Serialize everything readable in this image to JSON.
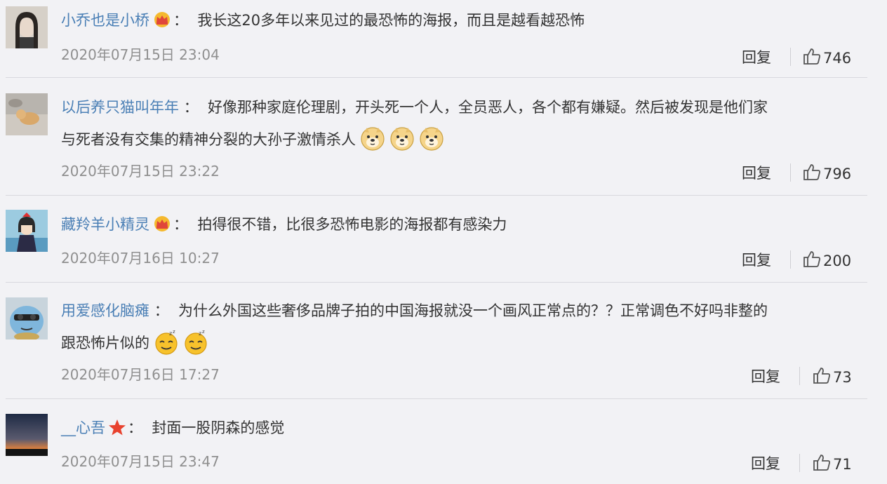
{
  "actions": {
    "reply_label": "回复"
  },
  "comments": [
    {
      "username": "小乔也是小桥",
      "badge": "crown-icon",
      "colon": "：",
      "text_lines": [
        "我长这20多年以来见过的最恐怖的海报，而且是越看越恐怖"
      ],
      "timestamp": "2020年07月15日 23:04",
      "likes": "746"
    },
    {
      "username": "以后养只猫叫年年",
      "badge": "",
      "colon": "：",
      "text_lines": [
        "好像那种家庭伦理剧，开头死一个人，全员恶人，各个都有嫌疑。然后被发现是他们家",
        "与死者没有交集的精神分裂的大孙子激情杀人"
      ],
      "emojis": [
        "doge-emoji",
        "doge-emoji",
        "doge-emoji"
      ],
      "timestamp": "2020年07月15日 23:22",
      "likes": "796"
    },
    {
      "username": "藏羚羊小精灵",
      "badge": "crown-icon",
      "colon": "：",
      "text_lines": [
        "拍得很不错，比很多恐怖电影的海报都有感染力"
      ],
      "timestamp": "2020年07月16日 10:27",
      "likes": "200"
    },
    {
      "username": "用爱感化脑瘫",
      "badge": "",
      "colon": "：",
      "text_lines": [
        "为什么外国这些奢侈品牌子拍的中国海报就没一个画风正常点的？？正常调色不好吗非整的",
        "跟恐怖片似的"
      ],
      "emojis": [
        "sleepy-emoji",
        "sleepy-emoji"
      ],
      "timestamp": "2020年07月16日 17:27",
      "likes": "73"
    },
    {
      "username": "__心吾",
      "badge": "star-icon",
      "colon": "：",
      "text_lines": [
        "封面一股阴森的感觉"
      ],
      "timestamp": "2020年07月15日 23:47",
      "likes": "71"
    }
  ],
  "colors": {
    "background": "#f2f2f5",
    "username": "#4a7fb5",
    "text": "#333333",
    "timestamp": "#8f8f8f",
    "divider": "#d9d9de"
  }
}
